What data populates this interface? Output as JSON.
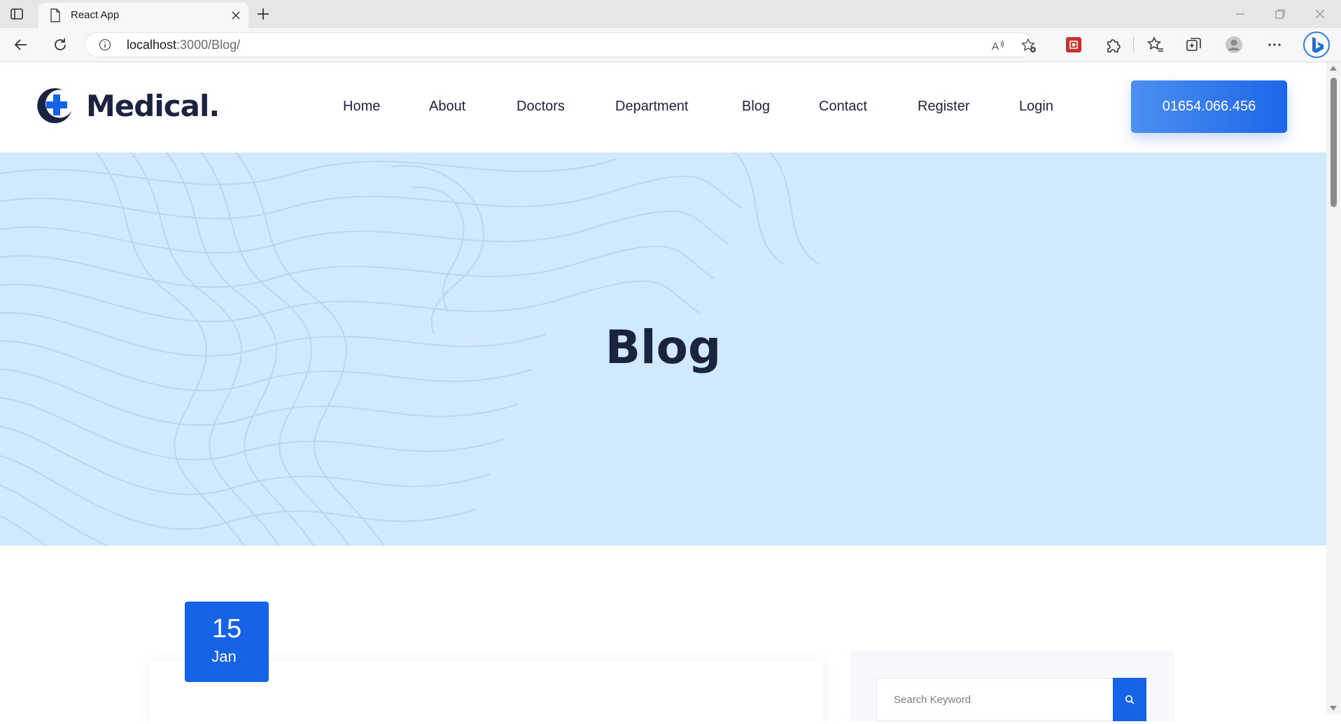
{
  "browser": {
    "tab_title": "React App",
    "url_host": "localhost",
    "url_rest": ":3000/Blog/"
  },
  "site": {
    "logo_text": "Medical.",
    "nav": [
      {
        "label": "Home"
      },
      {
        "label": "About"
      },
      {
        "label": "Doctors"
      },
      {
        "label": "Department"
      },
      {
        "label": "Blog"
      },
      {
        "label": "Contact"
      },
      {
        "label": "Register"
      },
      {
        "label": "Login"
      }
    ],
    "phone": "01654.066.456",
    "accent_color": "#1663e8",
    "hero_title": "Blog",
    "post": {
      "day": "15",
      "month": "Jan"
    },
    "search": {
      "placeholder": "Search Keyword"
    }
  }
}
